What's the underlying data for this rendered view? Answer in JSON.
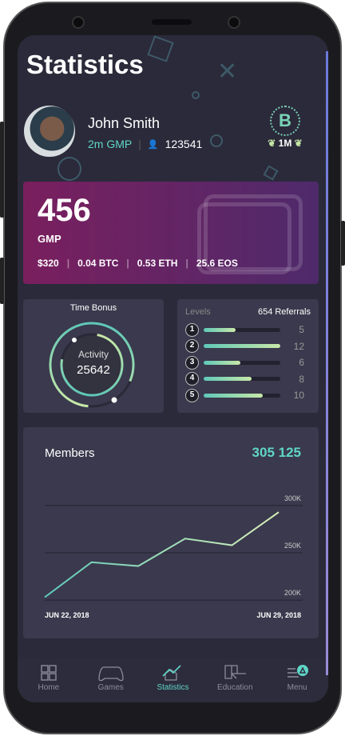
{
  "header": {
    "title": "Statistics"
  },
  "profile": {
    "name": "John Smith",
    "gmp": "2m GMP",
    "id": "123541",
    "badge_symbol": "B",
    "badge_label": "1M"
  },
  "balance": {
    "amount": "456",
    "unit": "GMP",
    "usd": "$320",
    "btc": "0.04 BTC",
    "eth": "0.53 ETH",
    "eos": "25.6 EOS"
  },
  "time_bonus": {
    "title": "Time Bonus",
    "label": "Activity",
    "value": "25642",
    "outer_progress": 0.8,
    "inner_progress": 0.75
  },
  "levels": {
    "title": "Levels",
    "referrals": "654 Referrals",
    "items": [
      {
        "level": "1",
        "count": "5",
        "fill": 0.42
      },
      {
        "level": "2",
        "count": "12",
        "fill": 1.0
      },
      {
        "level": "3",
        "count": "6",
        "fill": 0.48
      },
      {
        "level": "4",
        "count": "8",
        "fill": 0.63
      },
      {
        "level": "5",
        "count": "10",
        "fill": 0.77
      }
    ]
  },
  "members": {
    "title": "Members",
    "total": "305 125"
  },
  "chart_data": {
    "type": "line",
    "x": [
      "JUN 22, 2018",
      "",
      "",
      "",
      "",
      "JUN 29, 2018"
    ],
    "values": [
      203000,
      240000,
      236000,
      265000,
      258000,
      293000
    ],
    "ylim": [
      190000,
      300000
    ],
    "yticks": [
      "300K",
      "250K",
      "200K"
    ],
    "ytick_values": [
      300000,
      250000,
      200000
    ],
    "xlabels": [
      "JUN 22, 2018",
      "JUN 29, 2018"
    ],
    "color": "#a8e0c0"
  },
  "nav": [
    {
      "label": "Home"
    },
    {
      "label": "Games"
    },
    {
      "label": "Statistics",
      "active": true
    },
    {
      "label": "Education"
    },
    {
      "label": "Menu"
    }
  ],
  "colors": {
    "accent": "#5fd6c7",
    "screen": "#2b2a3a"
  }
}
